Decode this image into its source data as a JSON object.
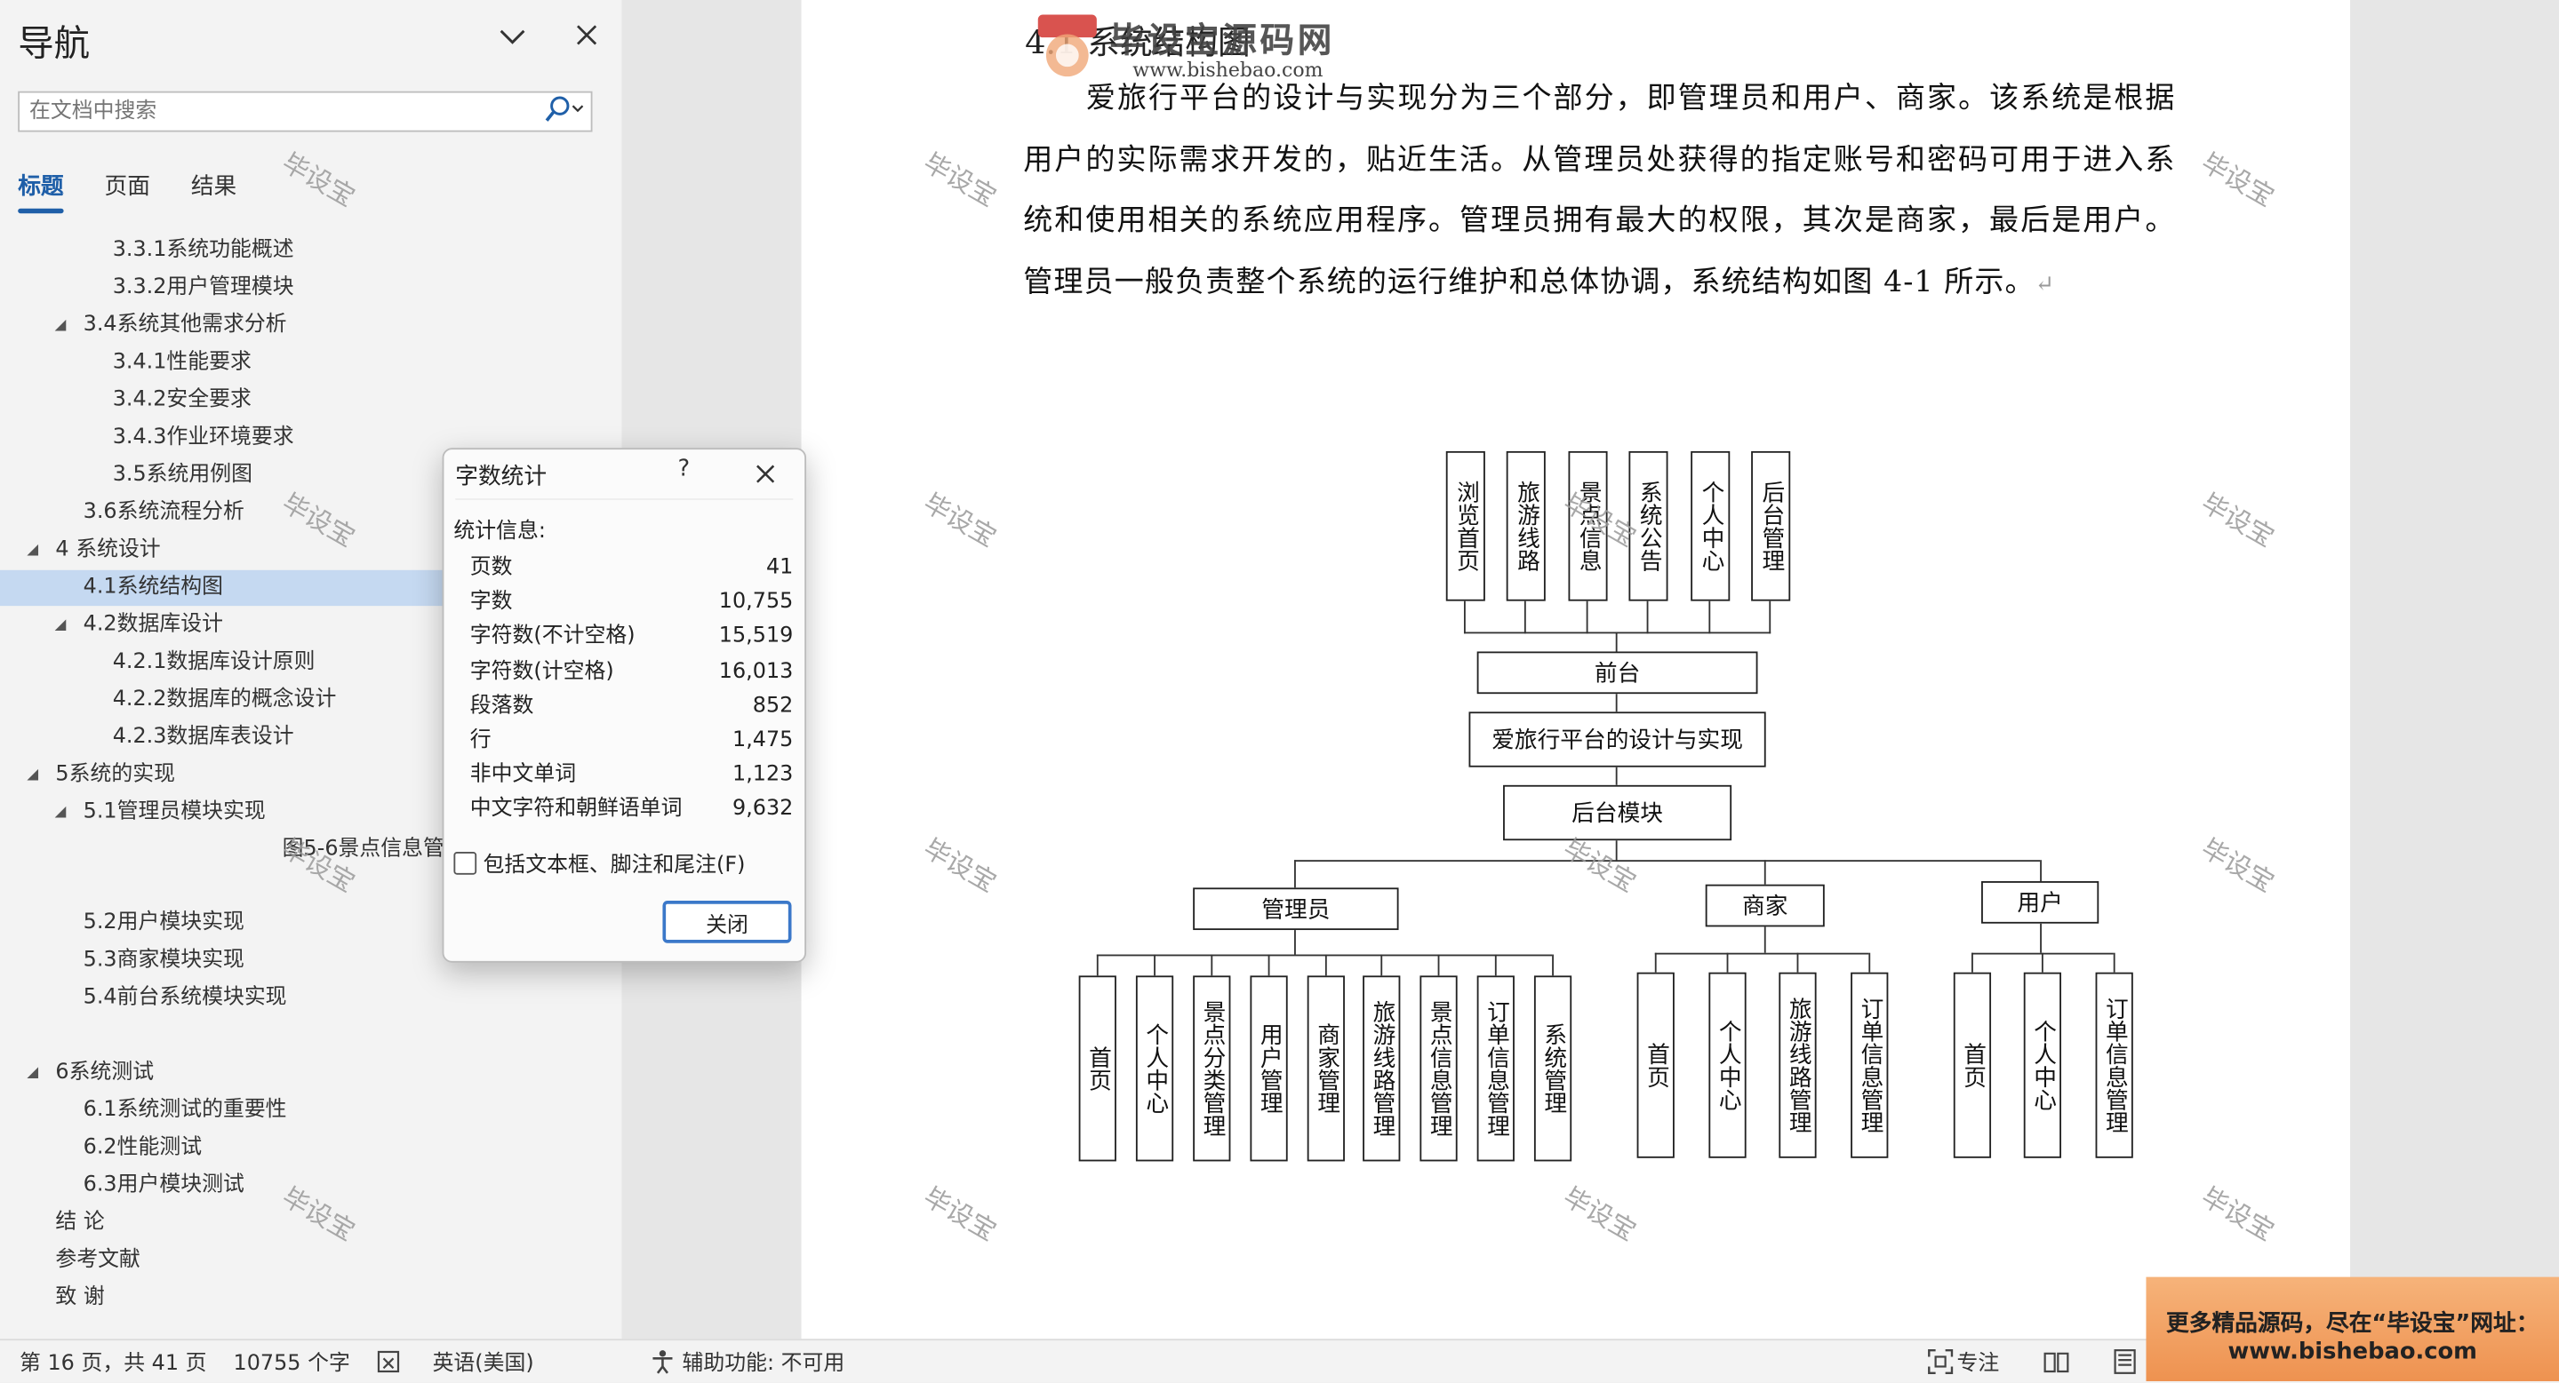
{
  "nav": {
    "title": "导航",
    "search_placeholder": "在文档中搜索",
    "tabs": [
      "标题",
      "页面",
      "结果"
    ],
    "tree": [
      {
        "label": "3.3.1系统功能概述"
      },
      {
        "label": "3.3.2用户管理模块"
      },
      {
        "label": "3.4系统其他需求分析",
        "toggle": "◢"
      },
      {
        "label": "3.4.1性能要求"
      },
      {
        "label": "3.4.2安全要求"
      },
      {
        "label": "3.4.3作业环境要求"
      },
      {
        "label": "3.5系统用例图"
      },
      {
        "label": "3.6系统流程分析"
      },
      {
        "label": "4 系统设计",
        "toggle": "◢"
      },
      {
        "label": "4.1系统结构图"
      },
      {
        "label": "4.2数据库设计",
        "toggle": "◢"
      },
      {
        "label": "4.2.1数据库设计原则"
      },
      {
        "label": "4.2.2数据库的概念设计"
      },
      {
        "label": "4.2.3数据库表设计"
      },
      {
        "label": "5系统的实现",
        "toggle": "◢"
      },
      {
        "label": "5.1管理员模块实现",
        "toggle": "◢"
      },
      {
        "label": "图5-6景点信息管"
      },
      {
        "label": "5.2用户模块实现"
      },
      {
        "label": "5.3商家模块实现"
      },
      {
        "label": "5.4前台系统模块实现"
      },
      {
        "label": "6系统测试",
        "toggle": "◢"
      },
      {
        "label": "6.1系统测试的重要性"
      },
      {
        "label": "6.2性能测试"
      },
      {
        "label": "6.3用户模块测试"
      },
      {
        "label": "结 论"
      },
      {
        "label": "参考文献"
      },
      {
        "label": "致 谢"
      }
    ]
  },
  "document": {
    "heading_fragment": "4.1 系统结构图",
    "paragraph": "爱旅行平台的设计与实现分为三个部分，即管理员和用户、商家。该系统是根据用户的实际需求开发的，贴近生活。从管理员处获得的指定账号和密码可用于进入系统和使用相关的系统应用程序。管理员拥有最大的权限，其次是商家，最后是用户。管理员一般负责整个系统的运行维护和总体协调，系统结构如图 4-1 所示。",
    "paragraph_mark": "↵",
    "logo_text": "毕设宝源码网",
    "logo_url": "www.bishebao.com",
    "watermark": "毕设宝"
  },
  "diagram": {
    "front_items": [
      "浏览首页",
      "旅游线路",
      "景点信息",
      "系统公告",
      "个人中心",
      "后台管理"
    ],
    "front": "前台",
    "root": "爱旅行平台的设计与实现",
    "backend": "后台模块",
    "groups": [
      {
        "name": "管理员",
        "items": [
          "首页",
          "个人中心",
          "景点分类管理",
          "用户管理",
          "商家管理",
          "旅游线路管理",
          "景点信息管理",
          "订单信息管理",
          "系统管理"
        ]
      },
      {
        "name": "商家",
        "items": [
          "首页",
          "个人中心",
          "旅游线路管理",
          "订单信息管理"
        ]
      },
      {
        "name": "用户",
        "items": [
          "首页",
          "个人中心",
          "订单信息管理"
        ]
      }
    ]
  },
  "dialog": {
    "title": "字数统计",
    "help": "?",
    "section": "统计信息:",
    "stats": [
      {
        "label": "页数",
        "value": "41"
      },
      {
        "label": "字数",
        "value": "10,755"
      },
      {
        "label": "字符数(不计空格)",
        "value": "15,519"
      },
      {
        "label": "字符数(计空格)",
        "value": "16,013"
      },
      {
        "label": "段落数",
        "value": "852"
      },
      {
        "label": "行",
        "value": "1,475"
      },
      {
        "label": "非中文单词",
        "value": "1,123"
      },
      {
        "label": "中文字符和朝鲜语单词",
        "value": "9,632"
      }
    ],
    "checkbox_label": "包括文本框、脚注和尾注(F)",
    "close_button": "关闭"
  },
  "status": {
    "page": "第 16 页，共 41 页",
    "words": "10755 个字",
    "language": "英语(美国)",
    "accessibility": "辅助功能: 不可用",
    "focus": "专注"
  },
  "promo": {
    "line1": "更多精品源码，尽在“毕设宝”网址：",
    "line2": "www.bishebao.com"
  }
}
